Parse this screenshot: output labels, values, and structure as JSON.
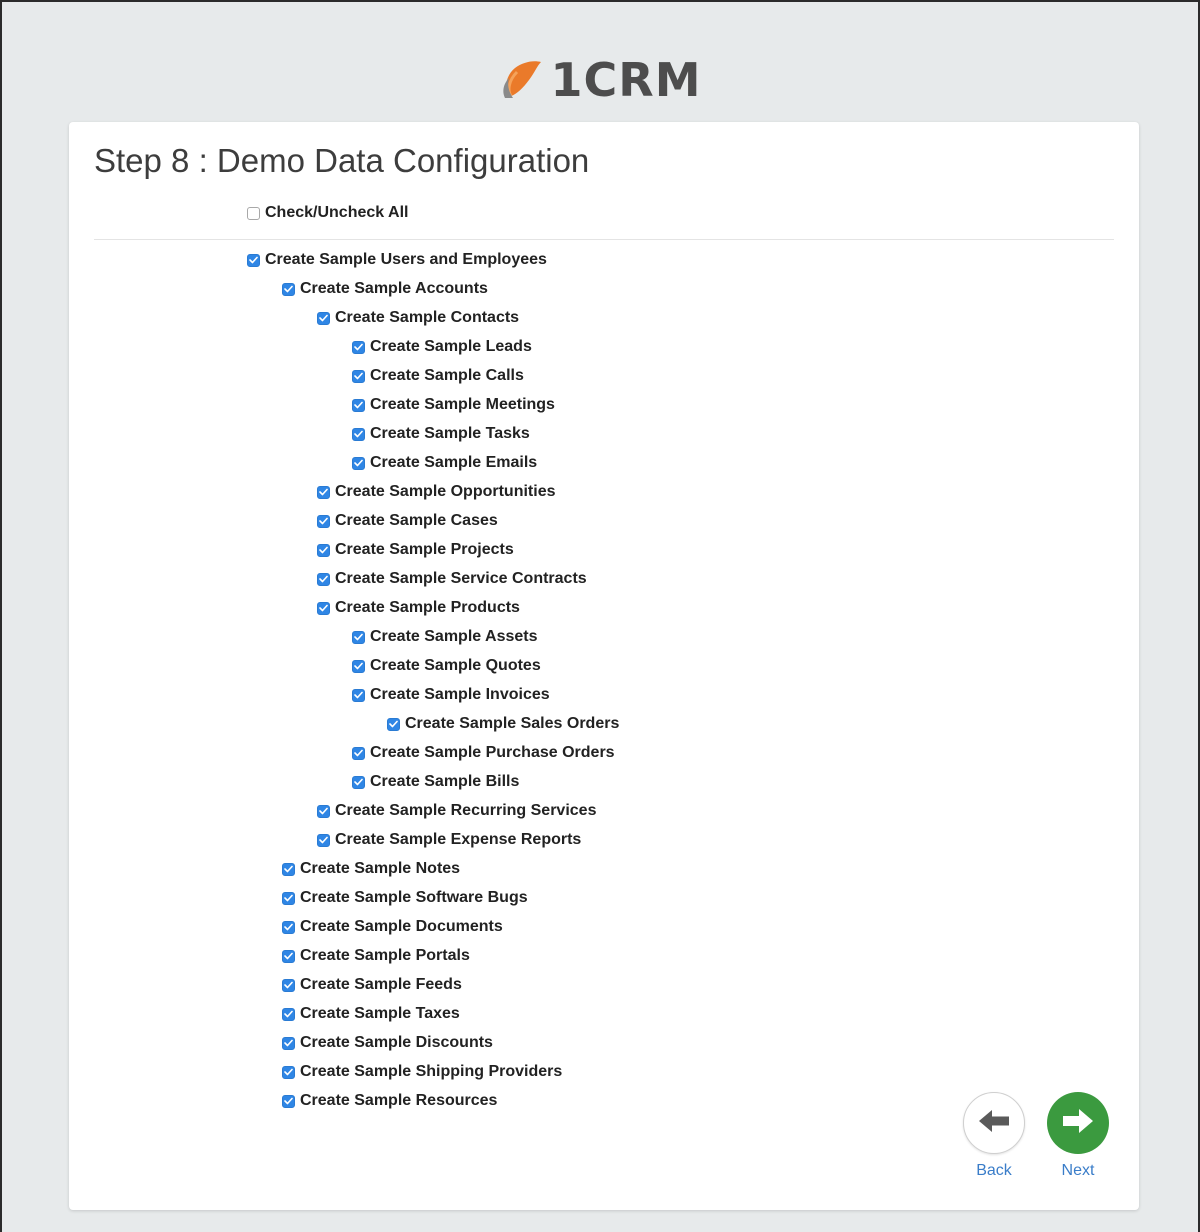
{
  "brand": {
    "logo_text": "1CRM"
  },
  "page_title": "Step 8 : Demo Data Configuration",
  "master_toggle": {
    "label": "Check/Uncheck All",
    "checked": false
  },
  "colors": {
    "checkbox_checked": "#2f86e5",
    "next_button": "#3b9a3f",
    "link": "#3a7dc9",
    "logo_orange": "#ea7a2a"
  },
  "options": [
    {
      "label": "Create Sample Users and Employees",
      "level": 0,
      "checked": true
    },
    {
      "label": "Create Sample Accounts",
      "level": 1,
      "checked": true
    },
    {
      "label": "Create Sample Contacts",
      "level": 2,
      "checked": true
    },
    {
      "label": "Create Sample Leads",
      "level": 3,
      "checked": true
    },
    {
      "label": "Create Sample Calls",
      "level": 3,
      "checked": true
    },
    {
      "label": "Create Sample Meetings",
      "level": 3,
      "checked": true
    },
    {
      "label": "Create Sample Tasks",
      "level": 3,
      "checked": true
    },
    {
      "label": "Create Sample Emails",
      "level": 3,
      "checked": true
    },
    {
      "label": "Create Sample Opportunities",
      "level": 2,
      "checked": true
    },
    {
      "label": "Create Sample Cases",
      "level": 2,
      "checked": true
    },
    {
      "label": "Create Sample Projects",
      "level": 2,
      "checked": true
    },
    {
      "label": "Create Sample Service Contracts",
      "level": 2,
      "checked": true
    },
    {
      "label": "Create Sample Products",
      "level": 2,
      "checked": true
    },
    {
      "label": "Create Sample Assets",
      "level": 3,
      "checked": true
    },
    {
      "label": "Create Sample Quotes",
      "level": 3,
      "checked": true
    },
    {
      "label": "Create Sample Invoices",
      "level": 3,
      "checked": true
    },
    {
      "label": "Create Sample Sales Orders",
      "level": 4,
      "checked": true
    },
    {
      "label": "Create Sample Purchase Orders",
      "level": 3,
      "checked": true
    },
    {
      "label": "Create Sample Bills",
      "level": 3,
      "checked": true
    },
    {
      "label": "Create Sample Recurring Services",
      "level": 2,
      "checked": true
    },
    {
      "label": "Create Sample Expense Reports",
      "level": 2,
      "checked": true
    },
    {
      "label": "Create Sample Notes",
      "level": 1,
      "checked": true
    },
    {
      "label": "Create Sample Software Bugs",
      "level": 1,
      "checked": true
    },
    {
      "label": "Create Sample Documents",
      "level": 1,
      "checked": true
    },
    {
      "label": "Create Sample Portals",
      "level": 1,
      "checked": true
    },
    {
      "label": "Create Sample Feeds",
      "level": 1,
      "checked": true
    },
    {
      "label": "Create Sample Taxes",
      "level": 1,
      "checked": true
    },
    {
      "label": "Create Sample Discounts",
      "level": 1,
      "checked": true
    },
    {
      "label": "Create Sample Shipping Providers",
      "level": 1,
      "checked": true
    },
    {
      "label": "Create Sample Resources",
      "level": 1,
      "checked": true
    }
  ],
  "nav": {
    "back": {
      "label": "Back",
      "icon": "arrow-left-icon"
    },
    "next": {
      "label": "Next",
      "icon": "arrow-right-icon"
    }
  }
}
